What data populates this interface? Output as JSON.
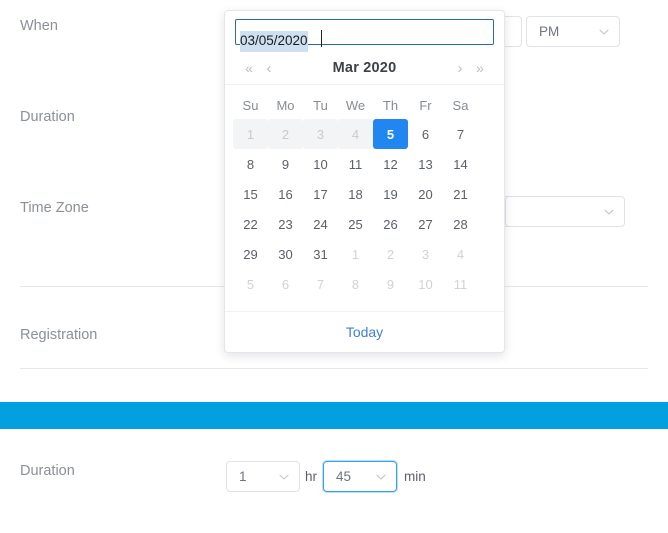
{
  "form": {
    "labels": {
      "when": "When",
      "duration": "Duration",
      "time_zone": "Time Zone",
      "registration": "Registration",
      "duration_bottom": "Duration"
    }
  },
  "controls": {
    "ampm": {
      "value": "PM",
      "caret_icon": "chevron-down-icon"
    },
    "timezone": {
      "value": "",
      "caret_icon": "chevron-down-icon"
    },
    "duration_hours": {
      "value": "1",
      "unit": "hr",
      "caret_icon": "chevron-down-icon"
    },
    "duration_minutes": {
      "value": "45",
      "unit": "min",
      "caret_icon": "chevron-down-icon"
    }
  },
  "banner": {
    "color": "#03a0e0"
  },
  "datepicker": {
    "input_value": "03/05/2020",
    "input_selected_text": "03/05/2020",
    "nav": {
      "prev_year_icon": "«",
      "prev_month_icon": "‹",
      "next_month_icon": "›",
      "next_year_icon": "»"
    },
    "title": "Mar 2020",
    "weekdays": [
      "Su",
      "Mo",
      "Tu",
      "We",
      "Th",
      "Fr",
      "Sa"
    ],
    "selected_day": "5",
    "accent_color": "#2186f0",
    "weeks": [
      [
        {
          "d": "1",
          "state": "disabled"
        },
        {
          "d": "2",
          "state": "disabled"
        },
        {
          "d": "3",
          "state": "disabled"
        },
        {
          "d": "4",
          "state": "disabled"
        },
        {
          "d": "5",
          "state": "selected"
        },
        {
          "d": "6",
          "state": "normal"
        },
        {
          "d": "7",
          "state": "normal"
        }
      ],
      [
        {
          "d": "8",
          "state": "normal"
        },
        {
          "d": "9",
          "state": "normal"
        },
        {
          "d": "10",
          "state": "normal"
        },
        {
          "d": "11",
          "state": "normal"
        },
        {
          "d": "12",
          "state": "normal"
        },
        {
          "d": "13",
          "state": "normal"
        },
        {
          "d": "14",
          "state": "normal"
        }
      ],
      [
        {
          "d": "15",
          "state": "normal"
        },
        {
          "d": "16",
          "state": "normal"
        },
        {
          "d": "17",
          "state": "normal"
        },
        {
          "d": "18",
          "state": "normal"
        },
        {
          "d": "19",
          "state": "normal"
        },
        {
          "d": "20",
          "state": "normal"
        },
        {
          "d": "21",
          "state": "normal"
        }
      ],
      [
        {
          "d": "22",
          "state": "normal"
        },
        {
          "d": "23",
          "state": "normal"
        },
        {
          "d": "24",
          "state": "normal"
        },
        {
          "d": "25",
          "state": "normal"
        },
        {
          "d": "26",
          "state": "normal"
        },
        {
          "d": "27",
          "state": "normal"
        },
        {
          "d": "28",
          "state": "normal"
        }
      ],
      [
        {
          "d": "29",
          "state": "normal"
        },
        {
          "d": "30",
          "state": "normal"
        },
        {
          "d": "31",
          "state": "normal"
        },
        {
          "d": "1",
          "state": "muted"
        },
        {
          "d": "2",
          "state": "muted"
        },
        {
          "d": "3",
          "state": "muted"
        },
        {
          "d": "4",
          "state": "muted"
        }
      ],
      [
        {
          "d": "5",
          "state": "muted"
        },
        {
          "d": "6",
          "state": "muted"
        },
        {
          "d": "7",
          "state": "muted"
        },
        {
          "d": "8",
          "state": "muted"
        },
        {
          "d": "9",
          "state": "muted"
        },
        {
          "d": "10",
          "state": "muted"
        },
        {
          "d": "11",
          "state": "muted"
        }
      ]
    ],
    "footer_label": "Today"
  }
}
